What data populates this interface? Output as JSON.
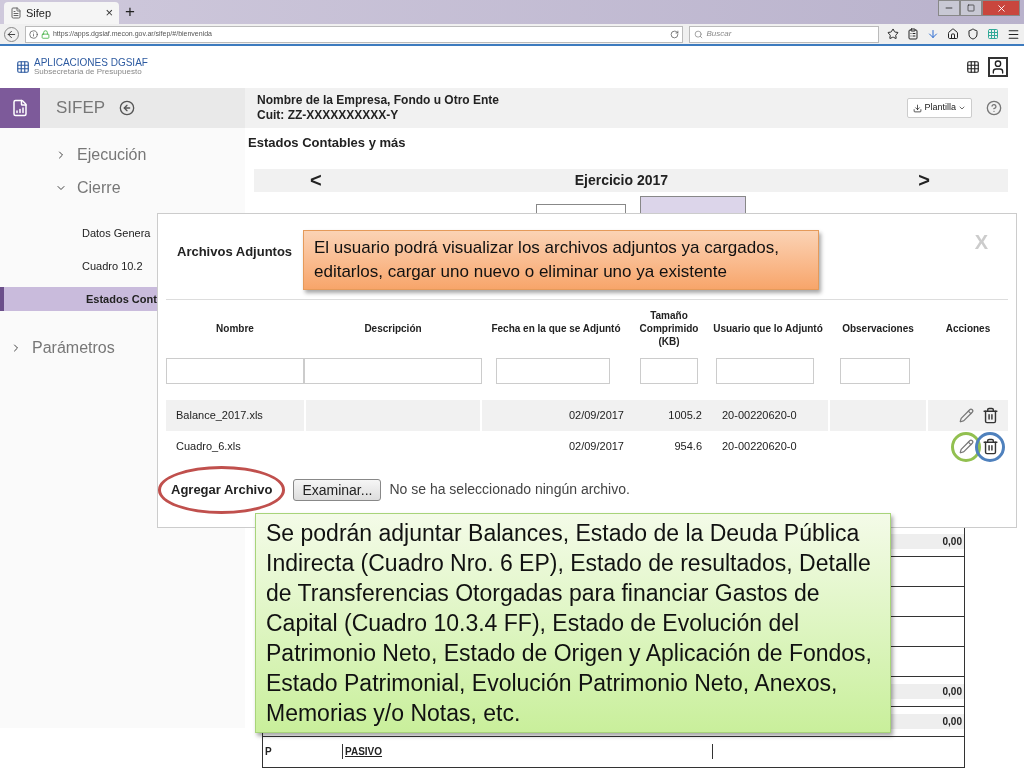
{
  "browser": {
    "tab_title": "Sifep",
    "tab_close": "×",
    "new_tab": "+",
    "url": "https://apps.dgsiaf.mecon.gov.ar/sifep/#/bienvenida",
    "search_placeholder": "Buscar"
  },
  "app_header": {
    "logo_title": "APLICACIONES DGSIAF",
    "logo_subtitle": "Subsecretaria de Presupuesto"
  },
  "sidebar": {
    "title": "SIFEP",
    "items": [
      {
        "label": "Ejecución",
        "expanded": false
      },
      {
        "label": "Cierre",
        "expanded": true,
        "children": [
          {
            "label": "Datos Genera",
            "selected": false
          },
          {
            "label": "Cuadro 10.2",
            "selected": false
          },
          {
            "label": "Estados Cont",
            "selected": true
          }
        ]
      },
      {
        "label": "Parámetros",
        "expanded": false
      }
    ]
  },
  "entity": {
    "name": "Nombre de la Empresa, Fondo u Otro Ente",
    "cuit": "Cuit: ZZ-XXXXXXXXXX-Y",
    "template_button": "Plantilla"
  },
  "section_title": "Estados Contables y más",
  "year_bar": {
    "prev": "<",
    "label": "Ejercicio 2017",
    "next": ">"
  },
  "year_tabs": [
    {
      "selected": false
    },
    {
      "selected": true
    }
  ],
  "background_table": {
    "rows": [
      {
        "code": "",
        "label": "",
        "value": "0,00"
      },
      {
        "code": "",
        "label": "",
        "value": ""
      },
      {
        "code": "",
        "label": "",
        "value": ""
      },
      {
        "code": "",
        "label": "",
        "value": ""
      },
      {
        "code": "",
        "label": "",
        "value": ""
      },
      {
        "code": "",
        "label": "",
        "value": "0,00"
      },
      {
        "code": "",
        "label": "",
        "value": "0,00"
      },
      {
        "code": "P",
        "label": "PASIVO",
        "value": ""
      }
    ]
  },
  "modal": {
    "title": "Archivos Adjuntos",
    "close": "X",
    "columns": [
      "Nombre",
      "Descripción",
      "Fecha en la que se Adjuntó",
      "Tamaño Comprimido (KB)",
      "Usuario que lo Adjuntó",
      "Observaciones",
      "Acciones"
    ],
    "rows": [
      {
        "name": "Balance_2017.xls",
        "description": "",
        "date": "02/09/2017",
        "size": "1005.2",
        "user": "20-00220620-0",
        "notes": "",
        "highlighted": true,
        "circled": false
      },
      {
        "name": "Cuadro_6.xls",
        "description": "",
        "date": "02/09/2017",
        "size": "954.6",
        "user": "20-00220620-0",
        "notes": "",
        "highlighted": false,
        "circled": true
      }
    ],
    "add_file": {
      "label": "Agregar Archivo",
      "button": "Examinar...",
      "status": "No se ha seleccionado ningún archivo.",
      "circled": true
    }
  },
  "callouts": [
    {
      "kind": "orange",
      "text": "El usuario podrá visualizar los archivos adjuntos  ya cargados, editarlos, cargar uno nuevo o eliminar uno ya existente"
    },
    {
      "kind": "green",
      "text": "Se podrán adjuntar Balances, Estado de la Deuda Pública Indirecta (Cuadro Nro. 6 EP), Estado de resultados, Detalle de Transferencias Otorgadas para financiar Gastos de Capital (Cuadro 10.3.4 FF),  Estado de Evolución del Patrimonio Neto, Estado de Origen y Aplicación de Fondos, Estado Patrimonial, Evolución Patrimonio Neto, Anexos, Memorias y/o Notas, etc."
    }
  ]
}
